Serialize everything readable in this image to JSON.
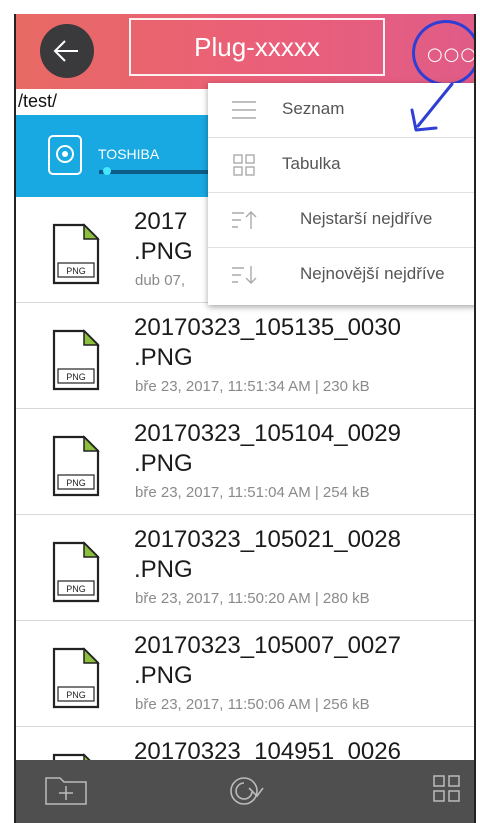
{
  "header": {
    "title": "Plug-xxxxx",
    "more_glyph": "○○○"
  },
  "path": "/test/",
  "storage": {
    "name": "TOSHIBA",
    "usage_fraction": 0.02
  },
  "menu": {
    "items": [
      {
        "label": "Seznam",
        "icon": "list-icon"
      },
      {
        "label": "Tabulka",
        "icon": "grid-icon"
      },
      {
        "label": "Nejstarší nejdříve",
        "icon": "sort-ascending-icon"
      },
      {
        "label": "Nejnovější nejdříve",
        "icon": "sort-descending-icon"
      }
    ]
  },
  "files": [
    {
      "name": "2017\n.PNG",
      "meta": "dub 07,",
      "type": "PNG"
    },
    {
      "name": "20170323_105135_0030\n.PNG",
      "meta": "bře 23, 2017, 11:51:34 AM | 230 kB",
      "type": "PNG"
    },
    {
      "name": "20170323_105104_0029\n.PNG",
      "meta": "bře 23, 2017, 11:51:04 AM | 254 kB",
      "type": "PNG"
    },
    {
      "name": "20170323_105021_0028\n.PNG",
      "meta": "bře 23, 2017, 11:50:20 AM | 280 kB",
      "type": "PNG"
    },
    {
      "name": "20170323_105007_0027\n.PNG",
      "meta": "bře 23, 2017, 11:50:06 AM | 256 kB",
      "type": "PNG"
    },
    {
      "name": "20170323_104951_0026",
      "meta": "",
      "type": "PNG"
    }
  ],
  "bottom_bar": {
    "buttons": [
      "new-folder-icon",
      "refresh-icon",
      "grid-view-icon"
    ]
  },
  "colors": {
    "header_start": "#e86a64",
    "header_end": "#e05c87",
    "storage_blue": "#18a9e3",
    "bottom_bar": "#4f4f4f",
    "annotation_blue": "#2f3fd6",
    "png_green": "#8bbf3c"
  }
}
